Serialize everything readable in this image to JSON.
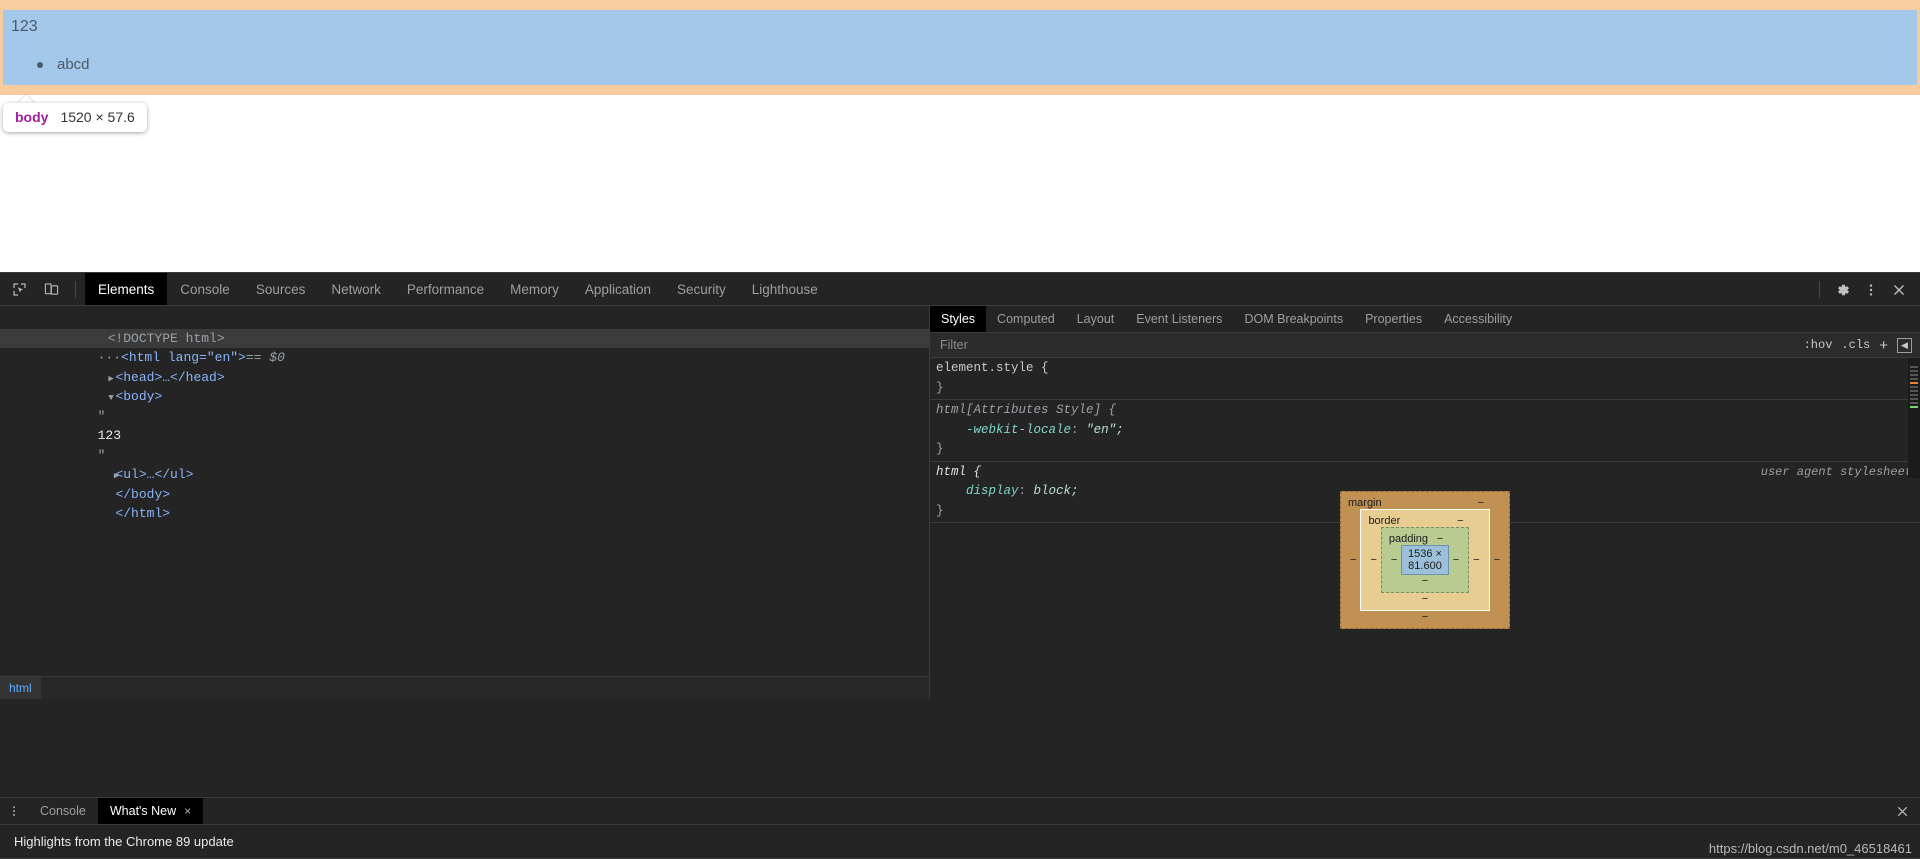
{
  "page": {
    "highlighted_text": "123",
    "list_items": [
      "abcd"
    ],
    "tooltip": {
      "tag": "body",
      "dimensions": "1520 × 57.6"
    },
    "colors": {
      "margin_highlight": "#f7cc9f",
      "content_highlight": "#a4c8ea"
    }
  },
  "devtools": {
    "toolbar": {
      "icons": [
        {
          "name": "inspect-element-icon",
          "label": "Inspect element"
        },
        {
          "name": "device-toolbar-icon",
          "label": "Toggle device toolbar"
        }
      ],
      "tabs": [
        {
          "label": "Elements",
          "active": true
        },
        {
          "label": "Console",
          "active": false
        },
        {
          "label": "Sources",
          "active": false
        },
        {
          "label": "Network",
          "active": false
        },
        {
          "label": "Performance",
          "active": false
        },
        {
          "label": "Memory",
          "active": false
        },
        {
          "label": "Application",
          "active": false
        },
        {
          "label": "Security",
          "active": false
        },
        {
          "label": "Lighthouse",
          "active": false
        }
      ],
      "right_icons": [
        {
          "name": "gear-icon",
          "label": "Settings"
        },
        {
          "name": "kebab-menu-icon",
          "label": "Customize and control DevTools"
        },
        {
          "name": "close-icon",
          "label": "Close DevTools"
        }
      ]
    },
    "dom_tree": {
      "rows": [
        {
          "id": "doctype",
          "text": "<!DOCTYPE html>"
        },
        {
          "id": "html-open",
          "text": "<html lang=\"en\">",
          "suffix": "== $0",
          "selected": true
        },
        {
          "id": "head",
          "text": "<head>…</head>"
        },
        {
          "id": "body-open",
          "text": "<body>"
        },
        {
          "id": "text-quote-open",
          "text": "\""
        },
        {
          "id": "text-value",
          "text": "123"
        },
        {
          "id": "text-quote-close",
          "text": "\""
        },
        {
          "id": "ul",
          "text": "<ul>…</ul>"
        },
        {
          "id": "body-close",
          "text": "</body>"
        },
        {
          "id": "html-close",
          "text": "</html>"
        }
      ],
      "breadcrumb": [
        "html"
      ]
    },
    "styles": {
      "tabs": [
        {
          "label": "Styles",
          "active": true
        },
        {
          "label": "Computed",
          "active": false
        },
        {
          "label": "Layout",
          "active": false
        },
        {
          "label": "Event Listeners",
          "active": false
        },
        {
          "label": "DOM Breakpoints",
          "active": false
        },
        {
          "label": "Properties",
          "active": false
        },
        {
          "label": "Accessibility",
          "active": false
        }
      ],
      "filter": {
        "placeholder": "Filter",
        "value": ""
      },
      "filter_actions": {
        "hov": ":hov",
        "cls": ".cls",
        "new_rule": "+",
        "toggle_sidebar": "◀"
      },
      "rules": [
        {
          "selector": "element.style {",
          "close": "}",
          "source": "",
          "declarations": []
        },
        {
          "selector": "html[Attributes Style] {",
          "close": "}",
          "source": "",
          "declarations": [
            {
              "property": "-webkit-locale",
              "value": "\"en\";"
            }
          ]
        },
        {
          "selector": "html {",
          "close": "}",
          "source": "user agent stylesheet",
          "declarations": [
            {
              "property": "display",
              "value": "block;"
            }
          ]
        }
      ],
      "box_model": {
        "margin_label": "margin",
        "margin_value": "−",
        "border_label": "border",
        "border_value": "−",
        "padding_label": "padding",
        "padding_value": "−",
        "content_size": "1536 × 81.600",
        "dash": "−",
        "colors": {
          "margin": "#c09153",
          "border": "#e8cd93",
          "padding": "#b8cc92",
          "content": "#9dc0da"
        }
      }
    },
    "drawer": {
      "tabs": [
        {
          "label": "Console",
          "active": false,
          "closable": false
        },
        {
          "label": "What's New",
          "active": true,
          "closable": true
        }
      ],
      "content": "Highlights from the Chrome 89 update",
      "close_label": "×"
    }
  },
  "watermark": "https://blog.csdn.net/m0_46518461"
}
